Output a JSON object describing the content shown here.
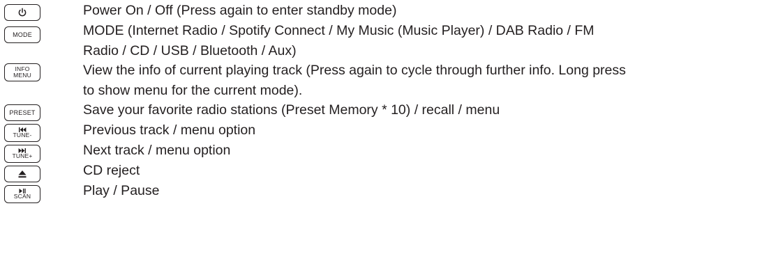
{
  "items": [
    {
      "key": {
        "icon": "power-icon"
      },
      "lines": [
        "Power On / Off (Press again to enter standby mode)"
      ]
    },
    {
      "key": {
        "label": "MODE"
      },
      "lines": [
        "MODE (Internet Radio / Spotify Connect / My Music (Music Player) / DAB Radio / FM",
        "Radio / CD / USB / Bluetooth / Aux)"
      ]
    },
    {
      "key": {
        "label_top": "INFO",
        "label_bottom": "MENU"
      },
      "lines": [
        "View the info of current playing track (Press again to cycle through further info. Long press",
        "to show menu for the current mode)."
      ]
    },
    {
      "key": {
        "label": "PRESET"
      },
      "lines": [
        "Save your favorite radio stations (Preset Memory * 10) / recall / menu"
      ]
    },
    {
      "key": {
        "icon": "skip-previous-icon",
        "label": "TUNE-"
      },
      "lines": [
        "Previous track / menu option"
      ]
    },
    {
      "key": {
        "icon": "skip-next-icon",
        "label": "TUNE+"
      },
      "lines": [
        "Next track / menu option"
      ]
    },
    {
      "key": {
        "icon": "eject-icon"
      },
      "lines": [
        "CD reject"
      ]
    },
    {
      "key": {
        "icon": "play-pause-icon",
        "label": "SCAN"
      },
      "lines": [
        "Play / Pause"
      ]
    }
  ]
}
